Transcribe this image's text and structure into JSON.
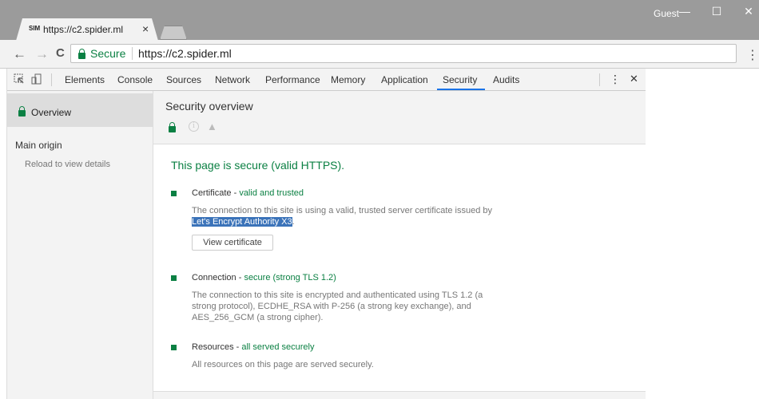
{
  "browser": {
    "tab_favicon": "SIM",
    "tab_title": "https://c2.spider.ml",
    "tab_close": "×",
    "guest_label": "Guest",
    "window_minimize": "—",
    "window_maximize": "☐",
    "window_close": "✕"
  },
  "toolbar": {
    "back": "←",
    "forward": "→",
    "reload": "C",
    "secure_label": "Secure",
    "url": "https://c2.spider.ml",
    "menu": "⋮"
  },
  "devtools": {
    "tabs": [
      "Elements",
      "Console",
      "Sources",
      "Network",
      "Performance",
      "Memory",
      "Application",
      "Security",
      "Audits"
    ],
    "active_tab": "Security",
    "more": "⋮",
    "close": "✕"
  },
  "sidebar": {
    "overview_label": "Overview",
    "main_origin_label": "Main origin",
    "reload_hint": "Reload to view details"
  },
  "summary": {
    "title": "Security overview"
  },
  "details": {
    "headline": "This page is secure (valid HTTPS).",
    "certificate": {
      "title": "Certificate",
      "sep": " - ",
      "status": "valid and trusted",
      "desc_prefix": "The connection to this site is using a valid, trusted server certificate issued by ",
      "desc_highlight": "Let's Encrypt Authority X3",
      "desc_suffix": ".",
      "button_label": "View certificate"
    },
    "connection": {
      "title": "Connection",
      "sep": " - ",
      "status": "secure (strong TLS 1.2)",
      "desc": "The connection to this site is encrypted and authenticated using TLS 1.2 (a strong protocol), ECDHE_RSA with P-256 (a strong key exchange), and AES_256_GCM (a strong cipher)."
    },
    "resources": {
      "title": "Resources",
      "sep": " - ",
      "status": "all served securely",
      "desc": "All resources on this page are served securely."
    }
  },
  "colors": {
    "secure_green": "#0b8043",
    "selection_blue": "#3b73b9",
    "active_tab_underline": "#1a73e8"
  }
}
